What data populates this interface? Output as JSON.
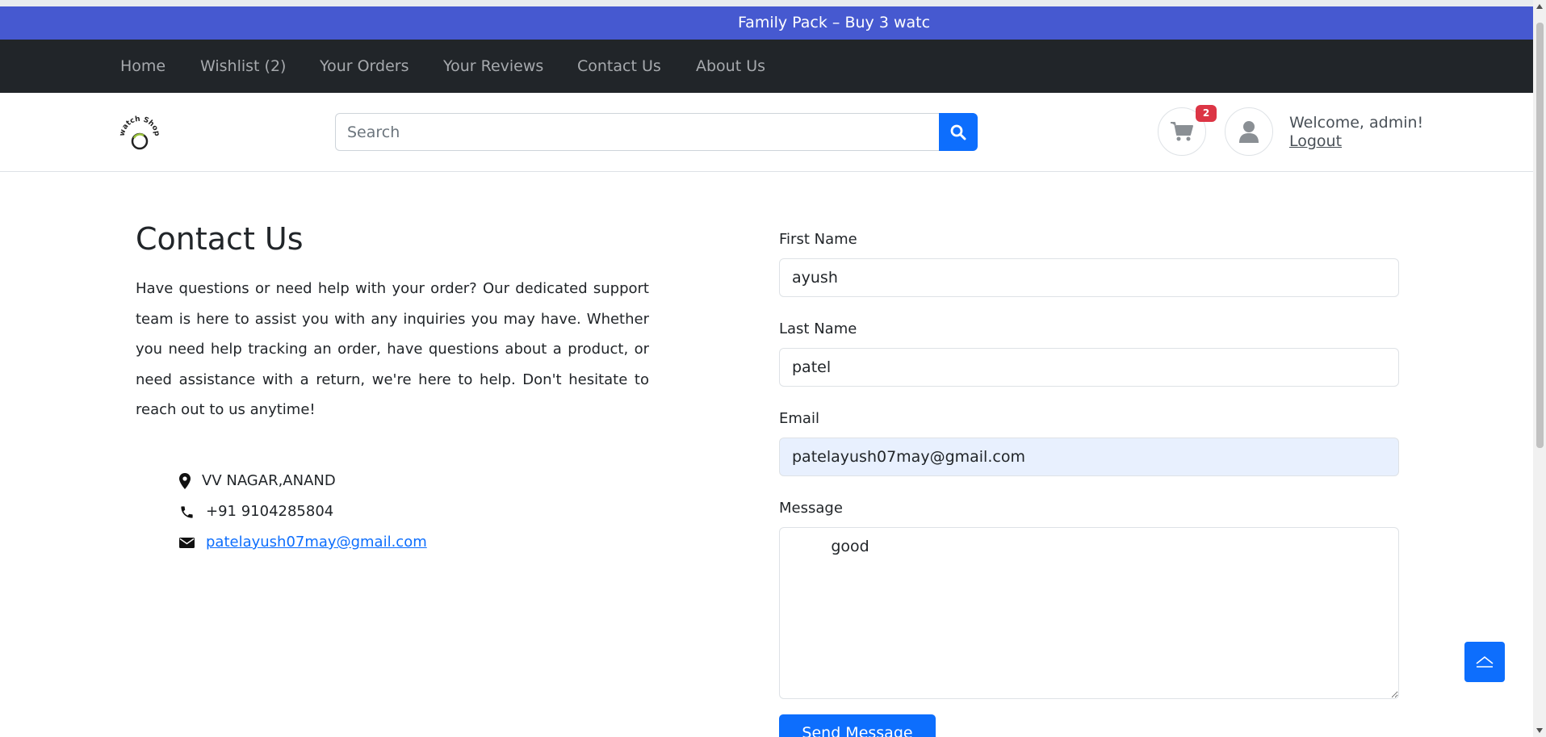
{
  "promo": {
    "text": "Family Pack – Buy 3 watc"
  },
  "nav": {
    "items": [
      {
        "label": "Home"
      },
      {
        "label": "Wishlist (2)"
      },
      {
        "label": "Your Orders"
      },
      {
        "label": "Your Reviews"
      },
      {
        "label": "Contact Us"
      },
      {
        "label": "About Us"
      }
    ]
  },
  "header": {
    "logo_text": "watch Shop",
    "search_placeholder": "Search",
    "cart_count": "2",
    "welcome": "Welcome, admin!",
    "logout": "Logout"
  },
  "contact": {
    "title": "Contact Us",
    "intro": "Have questions or need help with your order? Our dedicated support team is here to assist you with any inquiries you may have. Whether you need help tracking an order, have questions about a product, or need assistance with a return, we're here to help. Don't hesitate to reach out to us anytime!",
    "address": "VV NAGAR,ANAND",
    "phone": "+91 9104285804",
    "email": "patelayush07may@gmail.com"
  },
  "form": {
    "first_name_label": "First Name",
    "first_name_value": "ayush",
    "last_name_label": "Last Name",
    "last_name_value": "patel",
    "email_label": "Email",
    "email_value": "patelayush07may@gmail.com",
    "message_label": "Message",
    "message_value": "        good",
    "send_label": "Send Message"
  },
  "colors": {
    "promo_bg": "#4659d0",
    "navbar_bg": "#212529",
    "primary": "#0d6efd",
    "badge": "#dc3545"
  }
}
